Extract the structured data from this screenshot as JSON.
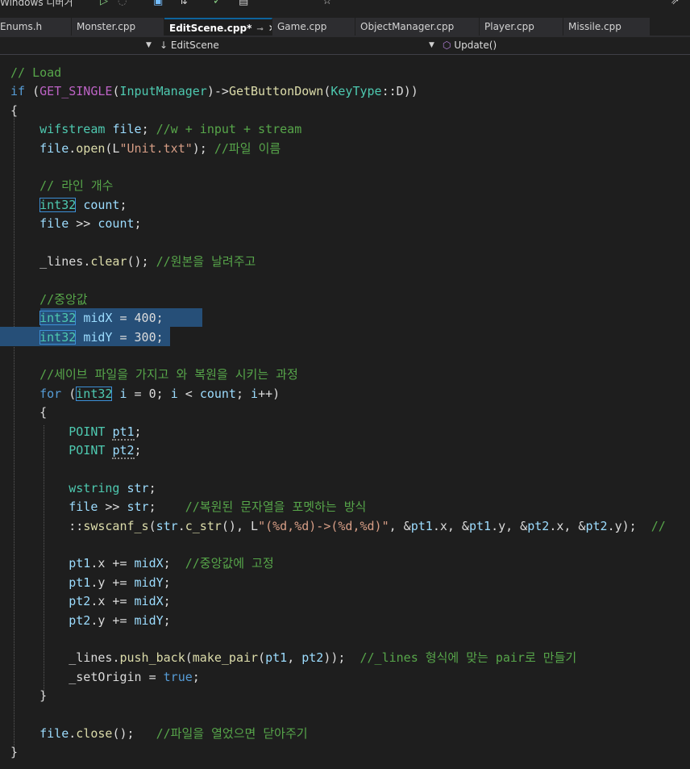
{
  "toolbar": {
    "title_fragment": "Windows 디버거",
    "icons": [
      "run-icon",
      "stop-icon",
      "save-icon",
      "diff-icon",
      "bookmark-icon",
      "star-icon",
      "share-icon"
    ]
  },
  "tabs": [
    {
      "label": "Enums.h",
      "active": false
    },
    {
      "label": "Monster.cpp",
      "active": false
    },
    {
      "label": "EditScene.cpp*",
      "active": true
    },
    {
      "label": "Game.cpp",
      "active": false
    },
    {
      "label": "ObjectManager.cpp",
      "active": false
    },
    {
      "label": "Player.cpp",
      "active": false
    },
    {
      "label": "Missile.cpp",
      "active": false
    }
  ],
  "navbar": {
    "scope": "EditScene",
    "member": "Update()"
  },
  "colors": {
    "keyword": "#569cd6",
    "type": "#4ec9b0",
    "function": "#dcdcaa",
    "comment": "#57a64a",
    "string": "#d69d85",
    "macro": "#bd63c5",
    "selection": "#264f78",
    "background": "#1e1e1e"
  },
  "code": [
    [
      [
        "cm",
        "// Load"
      ]
    ],
    [
      [
        "kw",
        "if"
      ],
      [
        "pl",
        " ("
      ],
      [
        "mc",
        "GET_SINGLE"
      ],
      [
        "pl",
        "("
      ],
      [
        "ty",
        "InputManager"
      ],
      [
        "pl",
        ")->"
      ],
      [
        "fn",
        "GetButtonDown"
      ],
      [
        "pl",
        "("
      ],
      [
        "ty",
        "KeyType"
      ],
      [
        "pl",
        "::"
      ],
      [
        "mb",
        "D"
      ],
      [
        "pl",
        "))"
      ]
    ],
    [
      [
        "pl",
        "{"
      ]
    ],
    [
      [
        "pl",
        "    "
      ],
      [
        "ty",
        "wifstream"
      ],
      [
        "pl",
        " "
      ],
      [
        "vr",
        "file"
      ],
      [
        "pl",
        "; "
      ],
      [
        "cm",
        "//w + input + stream"
      ]
    ],
    [
      [
        "pl",
        "    "
      ],
      [
        "vr",
        "file"
      ],
      [
        "pl",
        "."
      ],
      [
        "fn",
        "open"
      ],
      [
        "pl",
        "(L"
      ],
      [
        "st",
        "\"Unit.txt\""
      ],
      [
        "pl",
        "); "
      ],
      [
        "cm",
        "//파일 이름"
      ]
    ],
    [
      [
        "pl",
        ""
      ]
    ],
    [
      [
        "pl",
        "    "
      ],
      [
        "cm",
        "// 라인 개수"
      ]
    ],
    [
      [
        "pl",
        "    "
      ],
      [
        "ty",
        "int32",
        "box"
      ],
      [
        "pl",
        " "
      ],
      [
        "vr",
        "count"
      ],
      [
        "pl",
        ";"
      ]
    ],
    [
      [
        "pl",
        "    "
      ],
      [
        "vr",
        "file"
      ],
      [
        "pl",
        " >> "
      ],
      [
        "vr",
        "count"
      ],
      [
        "pl",
        ";"
      ]
    ],
    [
      [
        "pl",
        ""
      ]
    ],
    [
      [
        "pl",
        "    "
      ],
      [
        "mb",
        "_lines"
      ],
      [
        "pl",
        "."
      ],
      [
        "fn",
        "clear"
      ],
      [
        "pl",
        "(); "
      ],
      [
        "cm",
        "//원본을 날려주고"
      ]
    ],
    [
      [
        "pl",
        ""
      ]
    ],
    [
      [
        "pl",
        "    "
      ],
      [
        "cm",
        "//중앙값"
      ]
    ],
    [
      [
        "pl",
        "    "
      ],
      [
        "ty",
        "int32",
        "box"
      ],
      [
        "pl",
        " "
      ],
      [
        "vr",
        "midX"
      ],
      [
        "pl",
        " = "
      ],
      [
        "pl",
        "400"
      ],
      [
        "pl",
        ";"
      ]
    ],
    [
      [
        "pl",
        "    "
      ],
      [
        "ty",
        "int32",
        "box"
      ],
      [
        "pl",
        " "
      ],
      [
        "vr",
        "midY"
      ],
      [
        "pl",
        " = "
      ],
      [
        "pl",
        "300"
      ],
      [
        "pl",
        ";"
      ]
    ],
    [
      [
        "pl",
        ""
      ]
    ],
    [
      [
        "pl",
        "    "
      ],
      [
        "cm",
        "//세이브 파일을 가지고 와 복원을 시키는 과정"
      ]
    ],
    [
      [
        "pl",
        "    "
      ],
      [
        "kw",
        "for"
      ],
      [
        "pl",
        " ("
      ],
      [
        "ty",
        "int32",
        "box"
      ],
      [
        "pl",
        " "
      ],
      [
        "vr",
        "i"
      ],
      [
        "pl",
        " = 0; "
      ],
      [
        "vr",
        "i"
      ],
      [
        "pl",
        " < "
      ],
      [
        "vr",
        "count"
      ],
      [
        "pl",
        "; "
      ],
      [
        "vr",
        "i"
      ],
      [
        "pl",
        "++)"
      ]
    ],
    [
      [
        "pl",
        "    {"
      ]
    ],
    [
      [
        "pl",
        "        "
      ],
      [
        "ty",
        "POINT"
      ],
      [
        "pl",
        " "
      ],
      [
        "vr",
        "pt1",
        "squig"
      ],
      [
        "pl",
        ";"
      ]
    ],
    [
      [
        "pl",
        "        "
      ],
      [
        "ty",
        "POINT"
      ],
      [
        "pl",
        " "
      ],
      [
        "vr",
        "pt2",
        "squig"
      ],
      [
        "pl",
        ";"
      ]
    ],
    [
      [
        "pl",
        ""
      ]
    ],
    [
      [
        "pl",
        "        "
      ],
      [
        "ty",
        "wstring"
      ],
      [
        "pl",
        " "
      ],
      [
        "vr",
        "str"
      ],
      [
        "pl",
        ";"
      ]
    ],
    [
      [
        "pl",
        "        "
      ],
      [
        "vr",
        "file"
      ],
      [
        "pl",
        " >> "
      ],
      [
        "vr",
        "str"
      ],
      [
        "pl",
        ";    "
      ],
      [
        "cm",
        "//복원된 문자열을 포멧하는 방식"
      ]
    ],
    [
      [
        "pl",
        "        ::"
      ],
      [
        "fn",
        "swscanf_s"
      ],
      [
        "pl",
        "("
      ],
      [
        "vr",
        "str"
      ],
      [
        "pl",
        "."
      ],
      [
        "fn",
        "c_str"
      ],
      [
        "pl",
        "(), L"
      ],
      [
        "st",
        "\"(%d,%d)->(%d,%d)\""
      ],
      [
        "pl",
        ", &"
      ],
      [
        "vr",
        "pt1"
      ],
      [
        "pl",
        "."
      ],
      [
        "mb",
        "x"
      ],
      [
        "pl",
        ", &"
      ],
      [
        "vr",
        "pt1"
      ],
      [
        "pl",
        "."
      ],
      [
        "mb",
        "y"
      ],
      [
        "pl",
        ", &"
      ],
      [
        "vr",
        "pt2"
      ],
      [
        "pl",
        "."
      ],
      [
        "mb",
        "x"
      ],
      [
        "pl",
        ", &"
      ],
      [
        "vr",
        "pt2"
      ],
      [
        "pl",
        "."
      ],
      [
        "mb",
        "y"
      ],
      [
        "pl",
        ");  "
      ],
      [
        "cm",
        "//"
      ]
    ],
    [
      [
        "pl",
        ""
      ]
    ],
    [
      [
        "pl",
        "        "
      ],
      [
        "vr",
        "pt1"
      ],
      [
        "pl",
        "."
      ],
      [
        "mb",
        "x"
      ],
      [
        "pl",
        " += "
      ],
      [
        "vr",
        "midX"
      ],
      [
        "pl",
        ";  "
      ],
      [
        "cm",
        "//중앙값에 고정"
      ]
    ],
    [
      [
        "pl",
        "        "
      ],
      [
        "vr",
        "pt1"
      ],
      [
        "pl",
        "."
      ],
      [
        "mb",
        "y"
      ],
      [
        "pl",
        " += "
      ],
      [
        "vr",
        "midY"
      ],
      [
        "pl",
        ";"
      ]
    ],
    [
      [
        "pl",
        "        "
      ],
      [
        "vr",
        "pt2"
      ],
      [
        "pl",
        "."
      ],
      [
        "mb",
        "x"
      ],
      [
        "pl",
        " += "
      ],
      [
        "vr",
        "midX"
      ],
      [
        "pl",
        ";"
      ]
    ],
    [
      [
        "pl",
        "        "
      ],
      [
        "vr",
        "pt2"
      ],
      [
        "pl",
        "."
      ],
      [
        "mb",
        "y"
      ],
      [
        "pl",
        " += "
      ],
      [
        "vr",
        "midY"
      ],
      [
        "pl",
        ";"
      ]
    ],
    [
      [
        "pl",
        ""
      ]
    ],
    [
      [
        "pl",
        "        "
      ],
      [
        "mb",
        "_lines"
      ],
      [
        "pl",
        "."
      ],
      [
        "fn",
        "push_back"
      ],
      [
        "pl",
        "("
      ],
      [
        "fn",
        "make_pair"
      ],
      [
        "pl",
        "("
      ],
      [
        "vr",
        "pt1"
      ],
      [
        "pl",
        ", "
      ],
      [
        "vr",
        "pt2"
      ],
      [
        "pl",
        "));  "
      ],
      [
        "cm",
        "//_lines 형식에 맞는 pair로 만들기"
      ]
    ],
    [
      [
        "pl",
        "        "
      ],
      [
        "mb",
        "_setOrigin"
      ],
      [
        "pl",
        " = "
      ],
      [
        "kw",
        "true"
      ],
      [
        "pl",
        ";"
      ]
    ],
    [
      [
        "pl",
        "    }"
      ]
    ],
    [
      [
        "pl",
        ""
      ]
    ],
    [
      [
        "pl",
        "    "
      ],
      [
        "vr",
        "file"
      ],
      [
        "pl",
        "."
      ],
      [
        "fn",
        "close"
      ],
      [
        "pl",
        "();   "
      ],
      [
        "cm",
        "//파일을 열었으면 닫아주기"
      ]
    ],
    [
      [
        "pl",
        "}"
      ]
    ]
  ]
}
